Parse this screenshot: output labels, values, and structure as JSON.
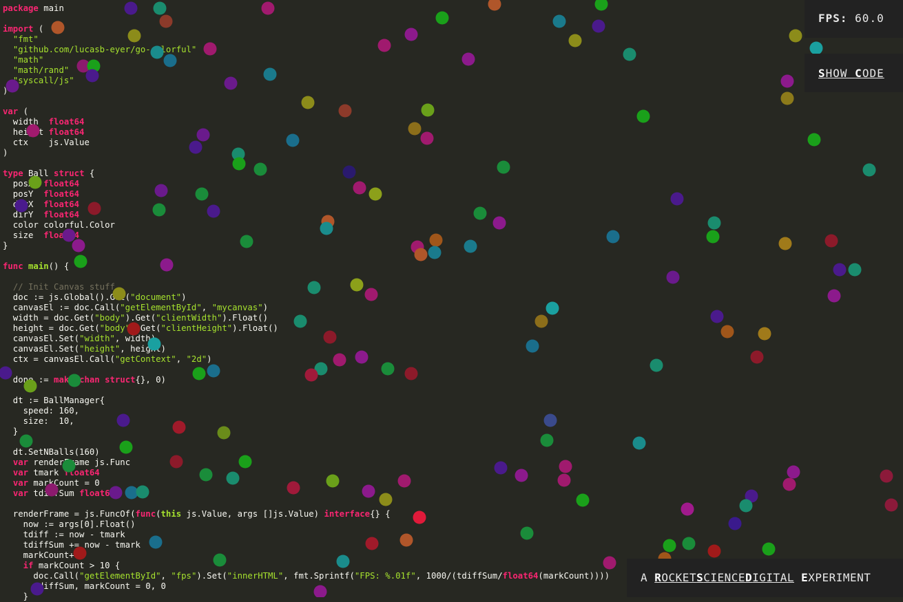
{
  "fps": {
    "label": "FPS:",
    "value": "60.0"
  },
  "show_code": {
    "first_letter": "S",
    "rest": "HOW ",
    "second_letter": "C",
    "tail": "ODE"
  },
  "footer": {
    "prefix": "A ",
    "link_parts": [
      "R",
      "OCKET",
      "S",
      "CIENCE",
      "D",
      "IGITAL"
    ],
    "suffix_parts": [
      "E",
      "XPERIMENT"
    ]
  },
  "code_lines": [
    "package main",
    "",
    "import (",
    "  \"fmt\"",
    "  \"github.com/lucasb-eyer/go-colorful\"",
    "  \"math\"",
    "  \"math/rand\"",
    "  \"syscall/js\"",
    ")",
    "",
    "var (",
    "  width  float64",
    "  height float64",
    "  ctx    js.Value",
    ")",
    "",
    "type Ball struct {",
    "  posX  float64",
    "  posY  float64",
    "  dirX  float64",
    "  dirY  float64",
    "  color colorful.Color",
    "  size  float64",
    "}",
    "",
    "func main() {",
    "",
    "  // Init Canvas stuff",
    "  doc := js.Global().Get(\"document\")",
    "  canvasEl := doc.Call(\"getElementById\", \"mycanvas\")",
    "  width = doc.Get(\"body\").Get(\"clientWidth\").Float()",
    "  height = doc.Get(\"body\").Get(\"clientHeight\").Float()",
    "  canvasEl.Set(\"width\", width)",
    "  canvasEl.Set(\"height\", height)",
    "  ctx = canvasEl.Call(\"getContext\", \"2d\")",
    "",
    "  done := make(chan struct{}, 0)",
    "",
    "  dt := BallManager{",
    "    speed: 160,",
    "    size:  10,",
    "  }",
    "",
    "  dt.SetNBalls(160)",
    "  var renderFrame js.Func",
    "  var tmark float64",
    "  var markCount = 0",
    "  var tdiffSum float64",
    "",
    "  renderFrame = js.FuncOf(func(this js.Value, args []js.Value) interface{} {",
    "    now := args[0].Float()",
    "    tdiff := now - tmark",
    "    tdiffSum += now - tmark",
    "    markCount++",
    "    if markCount > 10 {",
    "      doc.Call(\"getElementById\", \"fps\").Set(\"innerHTML\", fmt.Sprintf(\"FPS: %.01f\", 1000/(tdiffSum/float64(markCount))))",
    "      tdiffSum, markCount = 0, 0",
    "    }"
  ],
  "balls": [
    [
      "#4a1a8c",
      190,
      12
    ],
    [
      "#1a8c6e",
      232,
      12
    ],
    [
      "#a01a6e",
      389,
      12
    ],
    [
      "#b0562a",
      718,
      6
    ],
    [
      "#1aa01a",
      873,
      6
    ],
    [
      "#8c3a2a",
      241,
      31
    ],
    [
      "#1aa01a",
      642,
      26
    ],
    [
      "#1a7a8c",
      812,
      31
    ],
    [
      "#4a1a8c",
      869,
      38
    ],
    [
      "#b0562a",
      84,
      40
    ],
    [
      "#8c8c1a",
      195,
      52
    ],
    [
      "#8c1a8c",
      597,
      50
    ],
    [
      "#8c8c1a",
      835,
      59
    ],
    [
      "#a01a6e",
      558,
      66
    ],
    [
      "#a01a6e",
      305,
      71
    ],
    [
      "#1a8c8c",
      228,
      76
    ],
    [
      "#1a6e8c",
      247,
      88
    ],
    [
      "#8c1a6e",
      121,
      96
    ],
    [
      "#1aa01a",
      136,
      96
    ],
    [
      "#4a1a8c",
      134,
      110
    ],
    [
      "#1a8c6e",
      914,
      79
    ],
    [
      "#8c1a8c",
      680,
      86
    ],
    [
      "#1a7a8c",
      392,
      108
    ],
    [
      "#6a1a8c",
      18,
      125
    ],
    [
      "#6a1a8c",
      335,
      121
    ],
    [
      "#8c8c1a",
      1155,
      52
    ],
    [
      "#1aa0a0",
      1185,
      70
    ],
    [
      "#8c1a8c",
      1143,
      118
    ],
    [
      "#8c7a1a",
      1143,
      143
    ],
    [
      "#8c8c1a",
      447,
      149
    ],
    [
      "#8c3a2a",
      501,
      161
    ],
    [
      "#6aa01a",
      621,
      160
    ],
    [
      "#1aa01a",
      934,
      169
    ],
    [
      "#8c6e1a",
      602,
      187
    ],
    [
      "#a01a6e",
      620,
      201
    ],
    [
      "#1a6e8c",
      425,
      204
    ],
    [
      "#6a1a8c",
      295,
      196
    ],
    [
      "#4a1a8c",
      284,
      214
    ],
    [
      "#a01a6e",
      48,
      190
    ],
    [
      "#1aa01a",
      1182,
      203
    ],
    [
      "#1a8c6e",
      1262,
      247
    ],
    [
      "#1a8c6e",
      346,
      224
    ],
    [
      "#1aa01a",
      347,
      238
    ],
    [
      "#1a8c3a",
      378,
      246
    ],
    [
      "#2a1a6e",
      507,
      250
    ],
    [
      "#1a8c3a",
      731,
      243
    ],
    [
      "#a01a6e",
      522,
      273
    ],
    [
      "#8ca01a",
      545,
      282
    ],
    [
      "#6aa01a",
      51,
      265
    ],
    [
      "#6a1a8c",
      234,
      277
    ],
    [
      "#1a8c3a",
      293,
      282
    ],
    [
      "#4a1a8c",
      31,
      299
    ],
    [
      "#8c1a2a",
      137,
      303
    ],
    [
      "#4a1a8c",
      310,
      307
    ],
    [
      "#1a8c3a",
      231,
      305
    ],
    [
      "#1a8c3a",
      697,
      310
    ],
    [
      "#8c1a8c",
      725,
      324
    ],
    [
      "#4a1a8c",
      983,
      289
    ],
    [
      "#1a8c6e",
      1037,
      324
    ],
    [
      "#1aa01a",
      1035,
      344
    ],
    [
      "#1a6e8c",
      890,
      344
    ],
    [
      "#b0562a",
      476,
      322
    ],
    [
      "#1a8c8c",
      474,
      332
    ],
    [
      "#a0561a",
      633,
      349
    ],
    [
      "#a01a6e",
      606,
      359
    ],
    [
      "#b0562a",
      611,
      370
    ],
    [
      "#1a7a8c",
      631,
      367
    ],
    [
      "#1a7a8c",
      683,
      358
    ],
    [
      "#8c1a2a",
      1207,
      350
    ],
    [
      "#a07a1a",
      1140,
      354
    ],
    [
      "#6a1a8c",
      100,
      342
    ],
    [
      "#8c1a8c",
      114,
      357
    ],
    [
      "#1a8c3a",
      358,
      351
    ],
    [
      "#1aa01a",
      117,
      380
    ],
    [
      "#8c1a8c",
      242,
      385
    ],
    [
      "#4a1a8c",
      1219,
      392
    ],
    [
      "#1a8c6e",
      1241,
      392
    ],
    [
      "#6a1a8c",
      977,
      403
    ],
    [
      "#8c1a8c",
      1211,
      430
    ],
    [
      "#1a8c6e",
      456,
      418
    ],
    [
      "#8ca01a",
      518,
      414
    ],
    [
      "#a01a6e",
      539,
      428
    ],
    [
      "#8c8c1a",
      173,
      427
    ],
    [
      "#1aa0a0",
      802,
      448
    ],
    [
      "#8c6e1a",
      786,
      467
    ],
    [
      "#1a8c6e",
      436,
      467
    ],
    [
      "#4a1a8c",
      1041,
      460
    ],
    [
      "#a0561a",
      1056,
      482
    ],
    [
      "#a07a1a",
      1110,
      485
    ],
    [
      "#8c1a2a",
      479,
      490
    ],
    [
      "#a01a1a",
      194,
      478
    ],
    [
      "#1a6e8c",
      773,
      503
    ],
    [
      "#1aa0a0",
      224,
      500
    ],
    [
      "#a01a6e",
      493,
      523
    ],
    [
      "#8c1a8c",
      525,
      519
    ],
    [
      "#8c1a2a",
      1099,
      519
    ],
    [
      "#1a8c6e",
      953,
      531
    ],
    [
      "#1a8c6e",
      466,
      536
    ],
    [
      "#a01a3a",
      452,
      545
    ],
    [
      "#1a8c3a",
      563,
      536
    ],
    [
      "#8c1a2a",
      597,
      543
    ],
    [
      "#1aa01a",
      289,
      543
    ],
    [
      "#1a6e8c",
      310,
      539
    ],
    [
      "#4a1a8c",
      8,
      542
    ],
    [
      "#1a8c3a",
      108,
      553
    ],
    [
      "#6aa01a",
      44,
      561
    ],
    [
      "#4a1a8c",
      179,
      611
    ],
    [
      "#3a4a8c",
      799,
      611
    ],
    [
      "#a01a2a",
      260,
      621
    ],
    [
      "#6a8c1a",
      325,
      629
    ],
    [
      "#1a8c8c",
      928,
      644
    ],
    [
      "#1a8c3a",
      38,
      641
    ],
    [
      "#1a8c3a",
      794,
      640
    ],
    [
      "#1aa01a",
      183,
      650
    ],
    [
      "#8c1a2a",
      256,
      671
    ],
    [
      "#1aa01a",
      356,
      671
    ],
    [
      "#1a8c3a",
      100,
      677
    ],
    [
      "#a01a6e",
      821,
      678
    ],
    [
      "#4a1a8c",
      727,
      680
    ],
    [
      "#8c1a8c",
      757,
      691
    ],
    [
      "#1a8c3a",
      299,
      690
    ],
    [
      "#1a8c6e",
      338,
      695
    ],
    [
      "#6aa01a",
      483,
      699
    ],
    [
      "#a01a6e",
      587,
      699
    ],
    [
      "#a01a6e",
      819,
      698
    ],
    [
      "#8c1a8c",
      1152,
      686
    ],
    [
      "#a01a6e",
      1146,
      704
    ],
    [
      "#8c1a3a",
      1287,
      692
    ],
    [
      "#a01a3a",
      426,
      709
    ],
    [
      "#8c1a8c",
      535,
      714
    ],
    [
      "#8c8c1a",
      560,
      726
    ],
    [
      "#1aa01a",
      846,
      727
    ],
    [
      "#1a6e8c",
      191,
      716
    ],
    [
      "#1a8c6e",
      207,
      715
    ],
    [
      "#6a1a8c",
      168,
      716
    ],
    [
      "#8c1a6e",
      75,
      712
    ],
    [
      "#4a1a8c",
      1091,
      721
    ],
    [
      "#1a8c6e",
      1083,
      735
    ],
    [
      "#a01a8c",
      998,
      740
    ],
    [
      "#8c1a3a",
      1294,
      734
    ],
    [
      "#e01a3a",
      609,
      752
    ],
    [
      "#3a1a8c",
      1067,
      761
    ],
    [
      "#1a8c3a",
      765,
      775
    ],
    [
      "#b0562a",
      590,
      785
    ],
    [
      "#a01a2a",
      540,
      790
    ],
    [
      "#1a6e8c",
      226,
      788
    ],
    [
      "#1aa01a",
      972,
      793
    ],
    [
      "#1a8c3a",
      1000,
      790
    ],
    [
      "#a01a1a",
      1037,
      801
    ],
    [
      "#1aa01a",
      1116,
      798
    ],
    [
      "#a01a1a",
      116,
      804
    ],
    [
      "#1a8c8c",
      498,
      816
    ],
    [
      "#1a8c3a",
      319,
      814
    ],
    [
      "#a0561a",
      965,
      812
    ],
    [
      "#a01a6e",
      885,
      818
    ],
    [
      "#1aa01a",
      1160,
      838
    ],
    [
      "#4a1a8c",
      54,
      856
    ],
    [
      "#8c1a8c",
      465,
      860
    ],
    [
      "#1a8c3a",
      925,
      862
    ]
  ]
}
